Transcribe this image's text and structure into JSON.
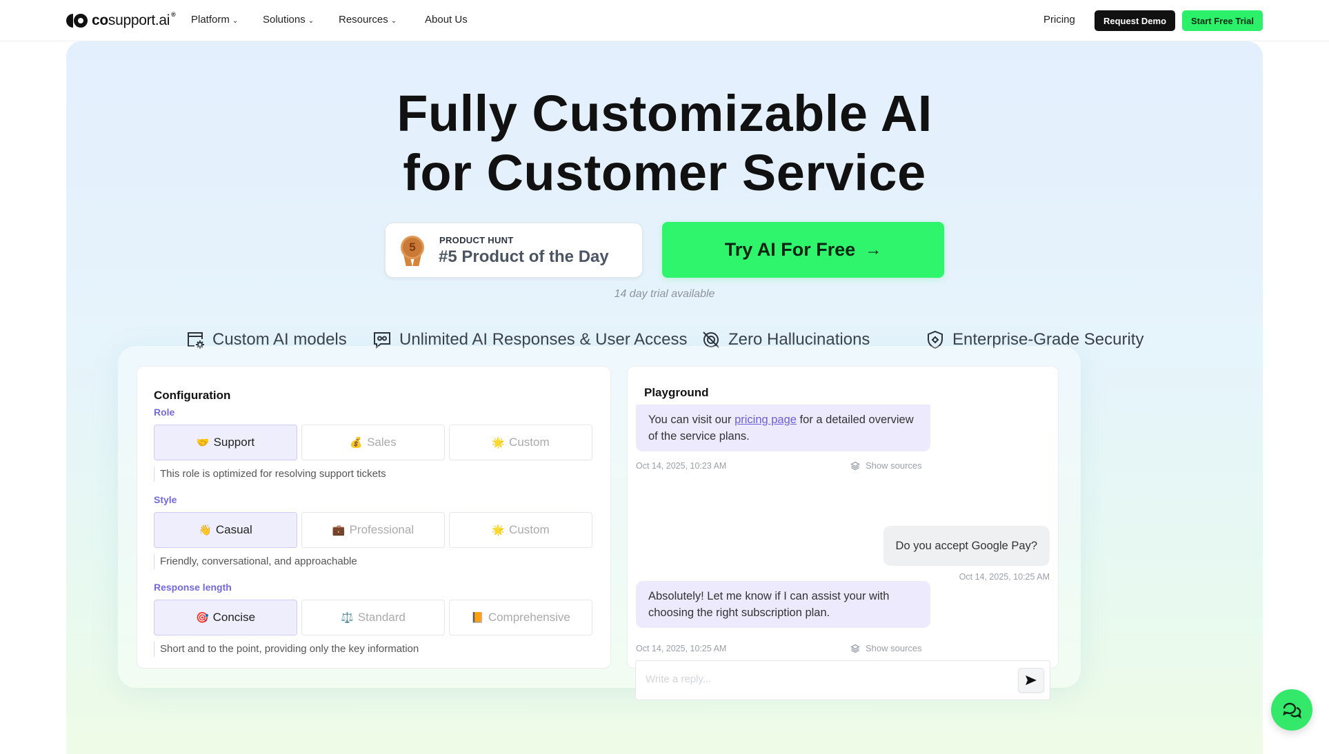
{
  "brand": {
    "name_bold": "co",
    "name_rest": "support.ai",
    "reg": "®"
  },
  "nav": {
    "items": [
      {
        "label": "Platform",
        "has_dropdown": true
      },
      {
        "label": "Solutions",
        "has_dropdown": true
      },
      {
        "label": "Resources",
        "has_dropdown": true
      },
      {
        "label": "About Us",
        "has_dropdown": false
      }
    ],
    "pricing": "Pricing",
    "request_demo": "Request Demo",
    "start_trial": "Start Free Trial"
  },
  "hero": {
    "title_line1": "Fully Customizable AI",
    "title_line2": "for Customer Service",
    "product_hunt": {
      "label": "PRODUCT HUNT",
      "value": "#5 Product of the Day",
      "rank": "5"
    },
    "cta": "Try AI For Free",
    "trial_note": "14 day trial available",
    "features": [
      {
        "label": "Custom AI models",
        "icon": "custom-model-icon"
      },
      {
        "label": "Unlimited AI Responses & User Access",
        "icon": "chat-bot-icon"
      },
      {
        "label": "Zero Hallucinations",
        "icon": "no-hallucination-icon"
      },
      {
        "label": "Enterprise-Grade Security",
        "icon": "shield-icon"
      }
    ]
  },
  "config": {
    "title": "Configuration",
    "role": {
      "label": "Role",
      "options": [
        {
          "emoji": "🤝",
          "label": "Support",
          "selected": true
        },
        {
          "emoji": "💰",
          "label": "Sales",
          "selected": false
        },
        {
          "emoji": "🌟",
          "label": "Custom",
          "selected": false
        }
      ],
      "description": "This role is optimized for resolving support tickets"
    },
    "style": {
      "label": "Style",
      "options": [
        {
          "emoji": "👋",
          "label": "Casual",
          "selected": true
        },
        {
          "emoji": "💼",
          "label": "Professional",
          "selected": false
        },
        {
          "emoji": "🌟",
          "label": "Custom",
          "selected": false
        }
      ],
      "description": "Friendly, conversational, and approachable"
    },
    "length": {
      "label": "Response length",
      "options": [
        {
          "emoji": "🎯",
          "label": "Concise",
          "selected": true
        },
        {
          "emoji": "⚖️",
          "label": "Standard",
          "selected": false
        },
        {
          "emoji": "📙",
          "label": "Comprehensive",
          "selected": false
        }
      ],
      "description": "Short and to the point, providing only the key information"
    }
  },
  "playground": {
    "title": "Playground",
    "messages": [
      {
        "from": "bot",
        "text_before": "You can visit our ",
        "link": "pricing page",
        "text_after": " for a detailed overview of the service plans.",
        "time": "Oct 14, 2025, 10:23 AM",
        "sources": "Show sources"
      },
      {
        "from": "user",
        "text": "Do you accept Google Pay?",
        "time": "Oct 14, 2025, 10:25 AM"
      },
      {
        "from": "bot",
        "text": "Absolutely! Let me know if I can assist your with choosing the right subscription plan.",
        "time": "Oct 14, 2025, 10:25 AM",
        "sources": "Show sources"
      }
    ],
    "reply_placeholder": "Write a reply..."
  },
  "colors": {
    "accent_green": "#2ef56c",
    "accent_purple": "#7268e0",
    "dark": "#111111"
  }
}
